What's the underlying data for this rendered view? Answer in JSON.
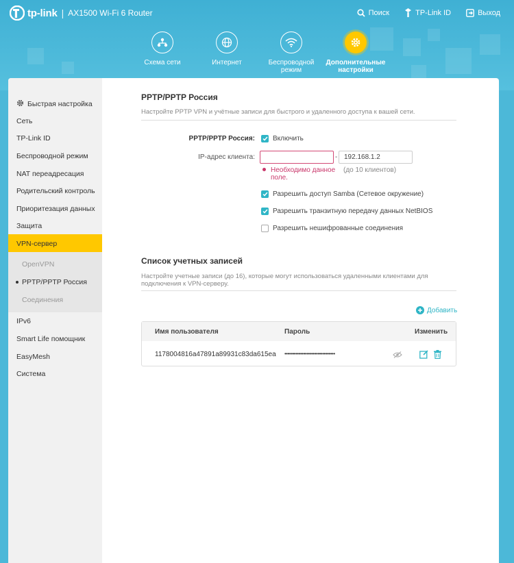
{
  "header": {
    "logo_text": "tp-link",
    "separator": "|",
    "model": "AX1500 Wi-Fi 6 Router",
    "actions": [
      {
        "label": "Поиск",
        "icon": "search-icon"
      },
      {
        "label": "TP-Link ID",
        "icon": "user-id-icon"
      },
      {
        "label": "Выход",
        "icon": "logout-icon"
      }
    ],
    "nav": [
      {
        "label": "Схема сети",
        "icon": "network-map-icon"
      },
      {
        "label": "Интернет",
        "icon": "globe-icon"
      },
      {
        "label": "Беспроводной режим",
        "icon": "wifi-icon"
      },
      {
        "label": "Дополнительные настройки",
        "icon": "gear-icon",
        "active": true
      }
    ],
    "colors": {
      "accent": "#ffc800",
      "brand": "#4cb8d8",
      "check": "#2fb5c6",
      "error": "#c9366a"
    }
  },
  "sidebar": {
    "items": [
      {
        "label": "Быстрая настройка",
        "icon": "gear-icon"
      },
      {
        "label": "Сеть"
      },
      {
        "label": "TP-Link ID"
      },
      {
        "label": "Беспроводной режим"
      },
      {
        "label": "NAT переадресация"
      },
      {
        "label": "Родительский контроль"
      },
      {
        "label": "Приоритезация данных"
      },
      {
        "label": "Защита"
      },
      {
        "label": "VPN-сервер",
        "active": true
      },
      {
        "label": "IPv6"
      },
      {
        "label": "Smart Life помощник"
      },
      {
        "label": "EasyMesh"
      },
      {
        "label": "Система"
      }
    ],
    "sub_items": [
      {
        "label": "OpenVPN"
      },
      {
        "label": "PPTP/PPTP Россия",
        "current": true
      },
      {
        "label": "Соединения"
      }
    ]
  },
  "pptp": {
    "title": "PPTP/PPTP Россия",
    "description": "Настройте PPTP VPN и учётные записи для быстрого и удаленного доступа к вашей сети.",
    "enable_label": "PPTP/PPTP Россия:",
    "enable_text": "Включить",
    "ip_label": "IP-адрес клиента:",
    "ip_start_value": "",
    "ip_dash": "-",
    "ip_end_value": "192.168.1.2",
    "error_text": "Необходимо данное поле.",
    "hint": "(до 10 клиентов)",
    "options": [
      {
        "label": "Разрешить доступ Samba (Сетевое окружение)",
        "checked": true
      },
      {
        "label": "Разрешить транзитную передачу данных NetBIOS",
        "checked": true
      },
      {
        "label": "Разрешить нешифрованные соединения",
        "checked": false
      }
    ]
  },
  "accounts": {
    "title": "Список учетных записей",
    "description": "Настройте учетные записи (до 16), которые могут использоваться удаленными клиентами для подключения к VPN-серверу.",
    "add_label": "Добавить",
    "columns": [
      "Имя пользователя",
      "Пароль",
      "Изменить"
    ],
    "rows": [
      {
        "username": "1178004816a47891a89931c83da615ea",
        "password": "••••••••••••••••••••••••••••••••"
      }
    ]
  }
}
